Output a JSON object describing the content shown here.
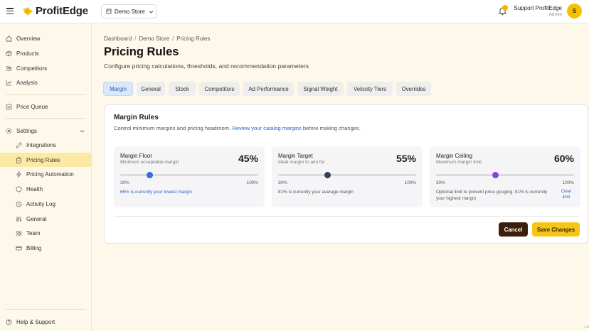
{
  "app": {
    "name": "ProfitEdge",
    "brand_color": "#f5c518"
  },
  "header": {
    "store_select": {
      "value": "Demo Store"
    },
    "user": {
      "name": "Support ProfitEdge",
      "role": "Admin",
      "initial": "S"
    }
  },
  "sidebar": {
    "items": [
      {
        "label": "Overview",
        "icon": "home-icon"
      },
      {
        "label": "Products",
        "icon": "box-icon"
      },
      {
        "label": "Competitors",
        "icon": "users-icon"
      },
      {
        "label": "Analysis",
        "icon": "chart-icon"
      },
      {
        "label": "Price Queue",
        "icon": "list-icon"
      },
      {
        "label": "Settings",
        "icon": "gear-icon"
      },
      {
        "label": "Integrations",
        "icon": "link-icon"
      },
      {
        "label": "Pricing Rules",
        "icon": "clipboard-icon",
        "active": true
      },
      {
        "label": "Pricing Automation",
        "icon": "bolt-icon"
      },
      {
        "label": "Health",
        "icon": "shield-icon"
      },
      {
        "label": "Activity Log",
        "icon": "clock-icon"
      },
      {
        "label": "General",
        "icon": "sliders-icon"
      },
      {
        "label": "Team",
        "icon": "team-icon"
      },
      {
        "label": "Billing",
        "icon": "card-icon"
      }
    ],
    "footer": "Help & Support"
  },
  "breadcrumb": [
    "Dashboard",
    "Demo Store",
    "Pricing Rules"
  ],
  "page": {
    "title": "Pricing Rules",
    "subtitle": "Configure pricing calculations, thresholds, and recommendation parameters"
  },
  "tabs": [
    "Margin",
    "General",
    "Stock",
    "Competitors",
    "Ad Performance",
    "Signal Weight",
    "Velocity Tiers",
    "Overrides"
  ],
  "card": {
    "title": "Margin Rules",
    "desc_before": "Control minimum margins and pricing headroom. ",
    "desc_link": "Review your catalog margins",
    "desc_after": " before making changes.",
    "panels": [
      {
        "title": "Margin Floor",
        "subtitle": "Minimum acceptable margin",
        "value": "45%",
        "min": "30%",
        "max": "100%",
        "slider_fraction": 0.2143,
        "thumb_color": "#2f6fe0",
        "note": "66% is currently your lowest margin"
      },
      {
        "title": "Margin Target",
        "subtitle": "Ideal margin to aim for",
        "value": "55%",
        "min": "30%",
        "max": "100%",
        "slider_fraction": 0.3571,
        "thumb_color": "#2d4257",
        "note": "81% is currently your average margin"
      },
      {
        "title": "Margin Ceiling",
        "subtitle": "Maximum margin limit",
        "value": "60%",
        "min": "30%",
        "max": "100%",
        "slider_fraction": 0.4286,
        "thumb_color": "#8a3fe0",
        "note": "Optional limit to prevent price gouging. 91% is currently your highest margin",
        "clear_link": "Clear limit"
      }
    ],
    "cancel": "Cancel",
    "save": "Save Changes"
  },
  "version": "v.0"
}
